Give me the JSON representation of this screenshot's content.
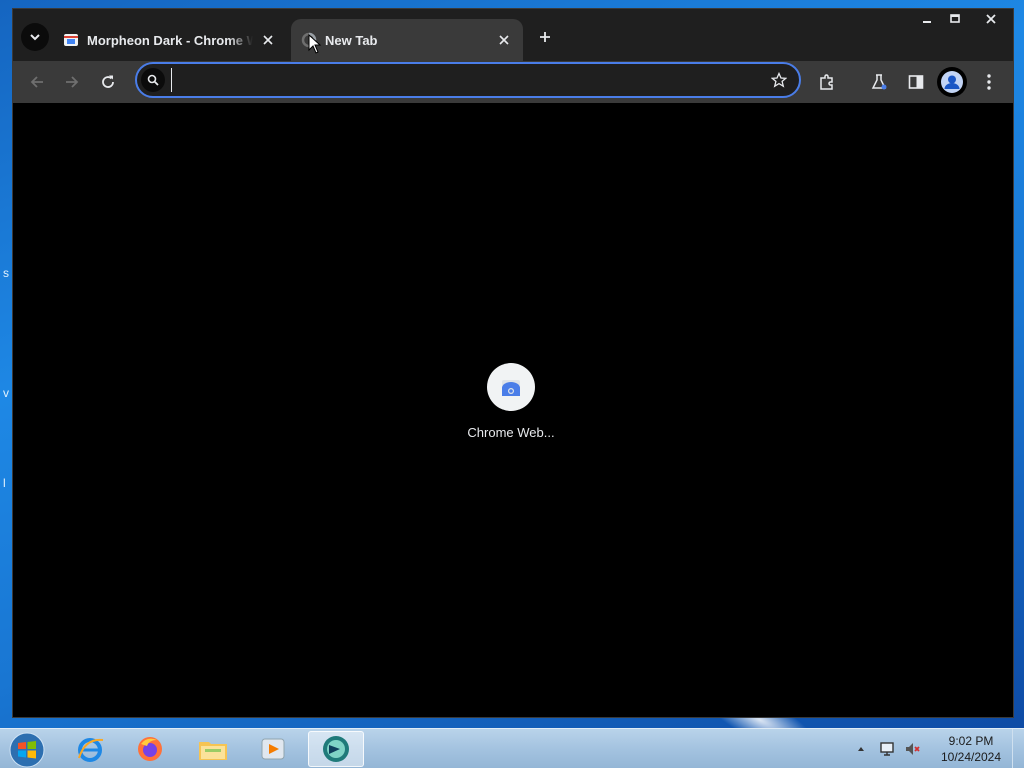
{
  "browser": {
    "tabs": [
      {
        "title": "Morpheon Dark - Chrome Web Store",
        "active": false
      },
      {
        "title": "New Tab",
        "active": true
      }
    ],
    "omnibox": {
      "value": "",
      "placeholder": ""
    },
    "shortcuts": [
      {
        "label": "Chrome Web..."
      }
    ]
  },
  "taskbar": {
    "apps": [
      "internet-explorer",
      "firefox",
      "file-explorer",
      "media-player",
      "chrome"
    ],
    "clock": {
      "time": "9:02 PM",
      "date": "10/24/2024"
    }
  },
  "colors": {
    "accent": "#4a7de8",
    "toolbar": "#3a3a3a",
    "titlebar": "#1f1f1f",
    "content": "#000000"
  }
}
